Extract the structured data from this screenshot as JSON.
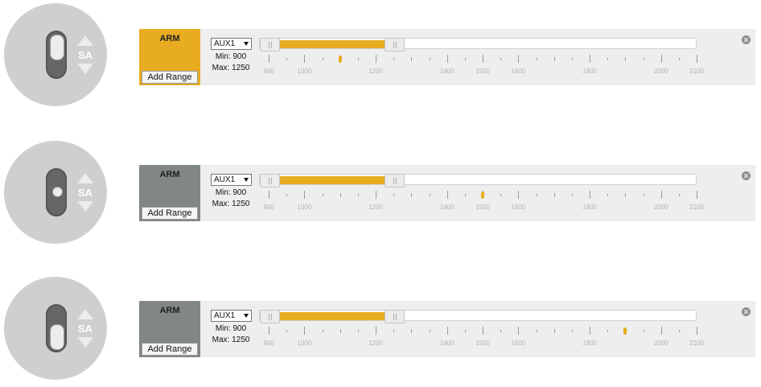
{
  "colors": {
    "active_mode": "#e8ac21",
    "inactive_mode": "#808784",
    "range_fill": "#e8ac21",
    "marker": "#e8ac21"
  },
  "rows": [
    {
      "switch": {
        "label": "SA",
        "position": "up"
      },
      "mode": {
        "name": "ARM",
        "active": true,
        "add_range_label": "Add Range"
      },
      "channel": {
        "selected": "AUX1"
      },
      "range": {
        "min_label": "Min: 900",
        "max_label": "Max: 1250",
        "min": 900,
        "max": 1250
      },
      "current_value": 1100
    },
    {
      "switch": {
        "label": "SA",
        "position": "middle"
      },
      "mode": {
        "name": "ARM",
        "active": false,
        "add_range_label": "Add Range"
      },
      "channel": {
        "selected": "AUX1"
      },
      "range": {
        "min_label": "Min: 900",
        "max_label": "Max: 1250",
        "min": 900,
        "max": 1250
      },
      "current_value": 1500
    },
    {
      "switch": {
        "label": "SA",
        "position": "down"
      },
      "mode": {
        "name": "ARM",
        "active": false,
        "add_range_label": "Add Range"
      },
      "channel": {
        "selected": "AUX1"
      },
      "range": {
        "min_label": "Min: 900",
        "max_label": "Max: 1250",
        "min": 900,
        "max": 1250
      },
      "current_value": 1900
    }
  ],
  "scale": {
    "min": 900,
    "max": 2100,
    "major_ticks": [
      900,
      1000,
      1200,
      1400,
      1500,
      1600,
      1800,
      2000,
      2100
    ],
    "minor_ticks": [
      1100,
      1300,
      1700,
      1900
    ],
    "labels": [
      "900",
      "1000",
      "1200",
      "1400",
      "1500",
      "1600",
      "1800",
      "2000",
      "2100"
    ]
  },
  "icons": {
    "close": "close-circle-icon",
    "handle": "drag-handle-icon",
    "dropdown": "chevron-down-icon"
  }
}
